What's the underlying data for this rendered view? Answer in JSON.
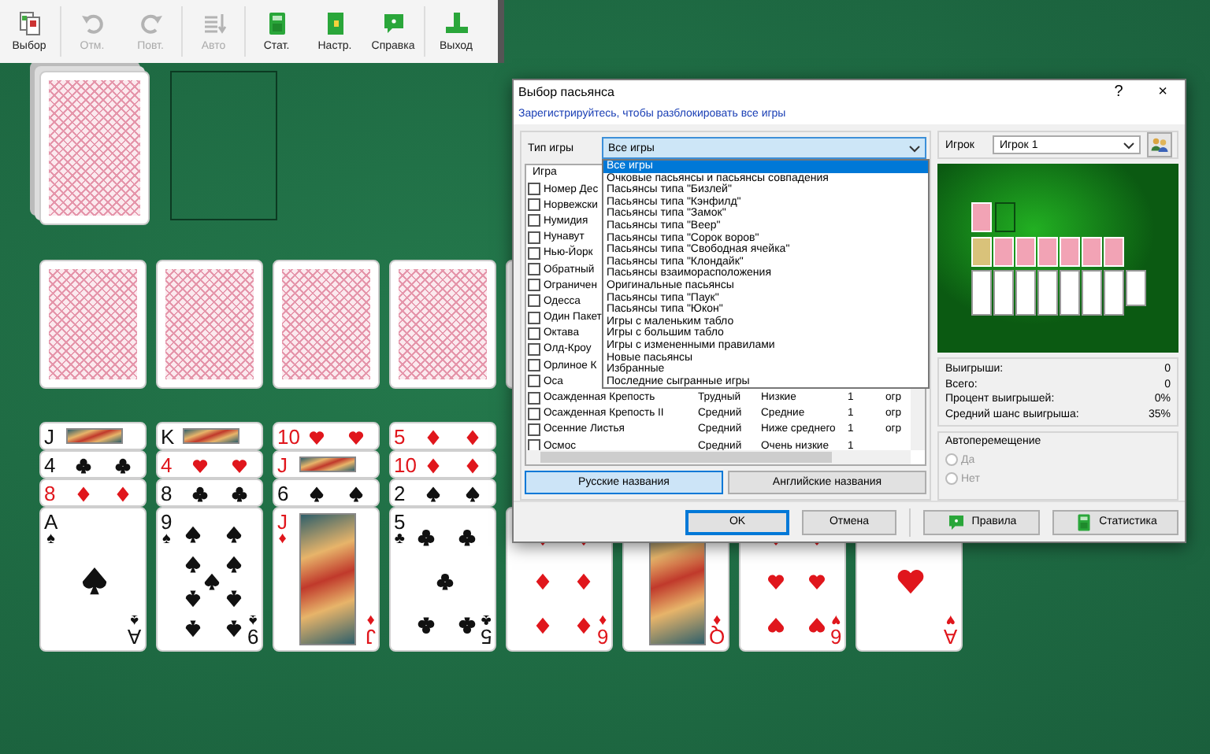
{
  "toolbar": {
    "groups": [
      [
        {
          "label": "Выбор",
          "kind": "choose",
          "disabled": false
        }
      ],
      [
        {
          "label": "Отм.",
          "kind": "undo",
          "disabled": true
        },
        {
          "label": "Повт.",
          "kind": "redo",
          "disabled": true
        }
      ],
      [
        {
          "label": "Авто",
          "kind": "auto",
          "disabled": true
        }
      ],
      [
        {
          "label": "Стат.",
          "kind": "stats",
          "disabled": false
        },
        {
          "label": "Настр.",
          "kind": "settings",
          "disabled": false
        },
        {
          "label": "Справка",
          "kind": "help",
          "disabled": false
        }
      ],
      [
        {
          "label": "Выход",
          "kind": "exit",
          "disabled": false
        }
      ]
    ]
  },
  "tableau": [
    {
      "cards": [
        {
          "kind": "face",
          "red": false,
          "index_top": {
            "rank": "J"
          }
        },
        {
          "kind": "strip",
          "pips": {
            "kind": "club"
          },
          "red": false,
          "index_top": {
            "rank": "4"
          }
        },
        {
          "kind": "strip",
          "pips": {
            "kind": "diamond"
          },
          "red": true,
          "index_top": {
            "rank": "8"
          }
        },
        {
          "kind": "ace",
          "pips": {
            "kind": "spade"
          },
          "red": false,
          "index_top": {
            "rank": "A",
            "suit": "♠"
          },
          "index_bottom": {
            "rank": "A",
            "suit": "♠"
          }
        }
      ]
    },
    {
      "cards": [
        {
          "kind": "face",
          "red": false,
          "index_top": {
            "rank": "K"
          }
        },
        {
          "kind": "strip",
          "pips": {
            "kind": "heart"
          },
          "red": true,
          "index_top": {
            "rank": "4"
          }
        },
        {
          "kind": "strip",
          "pips": {
            "kind": "club"
          },
          "red": false,
          "index_top": {
            "rank": "8"
          }
        },
        {
          "kind": "nine",
          "pips": {
            "kind": "spade"
          },
          "red": false,
          "index_top": {
            "rank": "9",
            "suit": "♠"
          },
          "index_bottom": {
            "rank": "9",
            "suit": "♠"
          }
        }
      ]
    },
    {
      "cards": [
        {
          "kind": "strip",
          "pips": {
            "kind": "heart"
          },
          "red": true,
          "index_top": {
            "rank": "10"
          }
        },
        {
          "kind": "face",
          "red": true,
          "index_top": {
            "rank": "J"
          }
        },
        {
          "kind": "strip",
          "pips": {
            "kind": "spade"
          },
          "red": false,
          "index_top": {
            "rank": "6"
          }
        },
        {
          "kind": "face",
          "red": true,
          "index_top": {
            "rank": "J",
            "suit": "♦"
          },
          "index_bottom": {
            "rank": "J",
            "suit": "♦"
          }
        }
      ]
    },
    {
      "cards": [
        {
          "kind": "strip",
          "pips": {
            "kind": "diamond"
          },
          "red": true,
          "index_top": {
            "rank": "5"
          }
        },
        {
          "kind": "strip",
          "pips": {
            "kind": "diamond"
          },
          "red": true,
          "index_top": {
            "rank": "10"
          }
        },
        {
          "kind": "strip",
          "pips": {
            "kind": "spade"
          },
          "red": false,
          "index_top": {
            "rank": "2"
          }
        },
        {
          "kind": "five",
          "pips": {
            "kind": "club"
          },
          "red": false,
          "index_top": {
            "rank": "5",
            "suit": "♣"
          },
          "index_bottom": {
            "rank": "5",
            "suit": "♣"
          }
        }
      ]
    },
    {
      "cards": [
        {
          "kind": "six",
          "pips": {
            "kind": "diamond"
          },
          "red": true,
          "index_bottom": {
            "rank": "6",
            "suit": "♦"
          }
        }
      ]
    },
    {
      "cards": [
        {
          "kind": "face",
          "red": true,
          "index_bottom": {
            "rank": "Q",
            "suit": "♦"
          }
        }
      ]
    },
    {
      "cards": [
        {
          "kind": "six",
          "pips": {
            "kind": "heart"
          },
          "red": true,
          "index_bottom": {
            "rank": "6",
            "suit": "♥"
          }
        }
      ]
    },
    {
      "cards": [
        {
          "kind": "ace",
          "pips": {
            "kind": "heart"
          },
          "red": true,
          "index_bottom": {
            "rank": "A",
            "suit": "♥"
          }
        }
      ]
    }
  ],
  "dialog": {
    "title": "Выбор пасьянса",
    "help": "?",
    "close": "×",
    "register_link": "Зарегистрируйтесь, чтобы разблокировать все игры",
    "game_type": {
      "label": "Тип игры",
      "value": "Все игры",
      "expanded": true,
      "options": [
        {
          "label": "Все игры",
          "selected": true
        },
        {
          "label": "Очковые пасьянсы и пасьянсы совпадения",
          "selected": false
        },
        {
          "label": "Пасьянсы типа \"Бизлей\"",
          "selected": false
        },
        {
          "label": "Пасьянсы типа \"Кэнфилд\"",
          "selected": false
        },
        {
          "label": "Пасьянсы типа \"Замок\"",
          "selected": false
        },
        {
          "label": "Пасьянсы типа \"Веер\"",
          "selected": false
        },
        {
          "label": "Пасьянсы типа \"Сорок воров\"",
          "selected": false
        },
        {
          "label": "Пасьянсы типа \"Свободная ячейка\"",
          "selected": false
        },
        {
          "label": "Пасьянсы типа \"Клондайк\"",
          "selected": false
        },
        {
          "label": "Пасьянсы взаиморасположения",
          "selected": false
        },
        {
          "label": "Оригинальные пасьянсы",
          "selected": false
        },
        {
          "label": "Пасьянсы типа \"Паук\"",
          "selected": false
        },
        {
          "label": "Пасьянсы типа \"Юкон\"",
          "selected": false
        },
        {
          "label": "Игры с маленьким табло",
          "selected": false
        },
        {
          "label": "Игры с большим табло",
          "selected": false
        },
        {
          "label": "Игры с измененными правилами",
          "selected": false
        },
        {
          "label": "Новые пасьянсы",
          "selected": false
        },
        {
          "label": "Избранные",
          "selected": false
        },
        {
          "label": "Последние сыгранные игры",
          "selected": false
        }
      ]
    },
    "games": {
      "column_header": "Игра",
      "rows": [
        {
          "name": "Номер Дес",
          "checked": false
        },
        {
          "name": "Норвежски",
          "checked": false
        },
        {
          "name": "Нумидия",
          "checked": false
        },
        {
          "name": "Нунавут",
          "checked": false
        },
        {
          "name": "Нью-Йорк",
          "checked": false
        },
        {
          "name": "Обратный",
          "checked": false
        },
        {
          "name": "Ограничен",
          "checked": false
        },
        {
          "name": "Одесса",
          "checked": false
        },
        {
          "name": "Один Пакет",
          "checked": false
        },
        {
          "name": "Октава",
          "checked": false
        },
        {
          "name": "Олд-Кроу",
          "checked": false
        },
        {
          "name": "Орлиное К",
          "checked": false
        },
        {
          "name": "Оса",
          "checked": false
        },
        {
          "name": "Осажденная Крепость",
          "checked": false,
          "cells": [
            "Трудный",
            "Низкие",
            "1",
            "огр"
          ]
        },
        {
          "name": "Осажденная Крепость II",
          "checked": false,
          "cells": [
            "Средний",
            "Средние",
            "1",
            "огр"
          ]
        },
        {
          "name": "Осенние Листья",
          "checked": false,
          "cells": [
            "Средний",
            "Ниже среднего",
            "1",
            "огр"
          ]
        },
        {
          "name": "Осмос",
          "checked": false,
          "cells": [
            "Средний",
            "Очень низкие",
            "1"
          ]
        }
      ]
    },
    "name_buttons": [
      {
        "label": "Русские названия",
        "selected": true
      },
      {
        "label": "Английские названия",
        "selected": false
      }
    ],
    "player": {
      "label": "Игрок",
      "value": "Игрок 1"
    },
    "stats": [
      {
        "label": "Выигрыши:",
        "value": "0"
      },
      {
        "label": "Всего:",
        "value": "0"
      },
      {
        "label": "Процент выигрышей:",
        "value": "0%"
      },
      {
        "label": "Средний шанс выигрыша:",
        "value": "35%"
      }
    ],
    "automove": {
      "label": "Автоперемещение",
      "options": [
        {
          "label": "Да",
          "selected": false,
          "disabled": true
        },
        {
          "label": "Нет",
          "selected": false,
          "disabled": true
        }
      ]
    },
    "buttons": [
      {
        "label": "OK",
        "kind": "default"
      },
      {
        "label": "Отмена",
        "kind": "plain"
      },
      {
        "label": "Правила",
        "kind": "rules"
      },
      {
        "label": "Статистика",
        "kind": "stats"
      }
    ]
  }
}
